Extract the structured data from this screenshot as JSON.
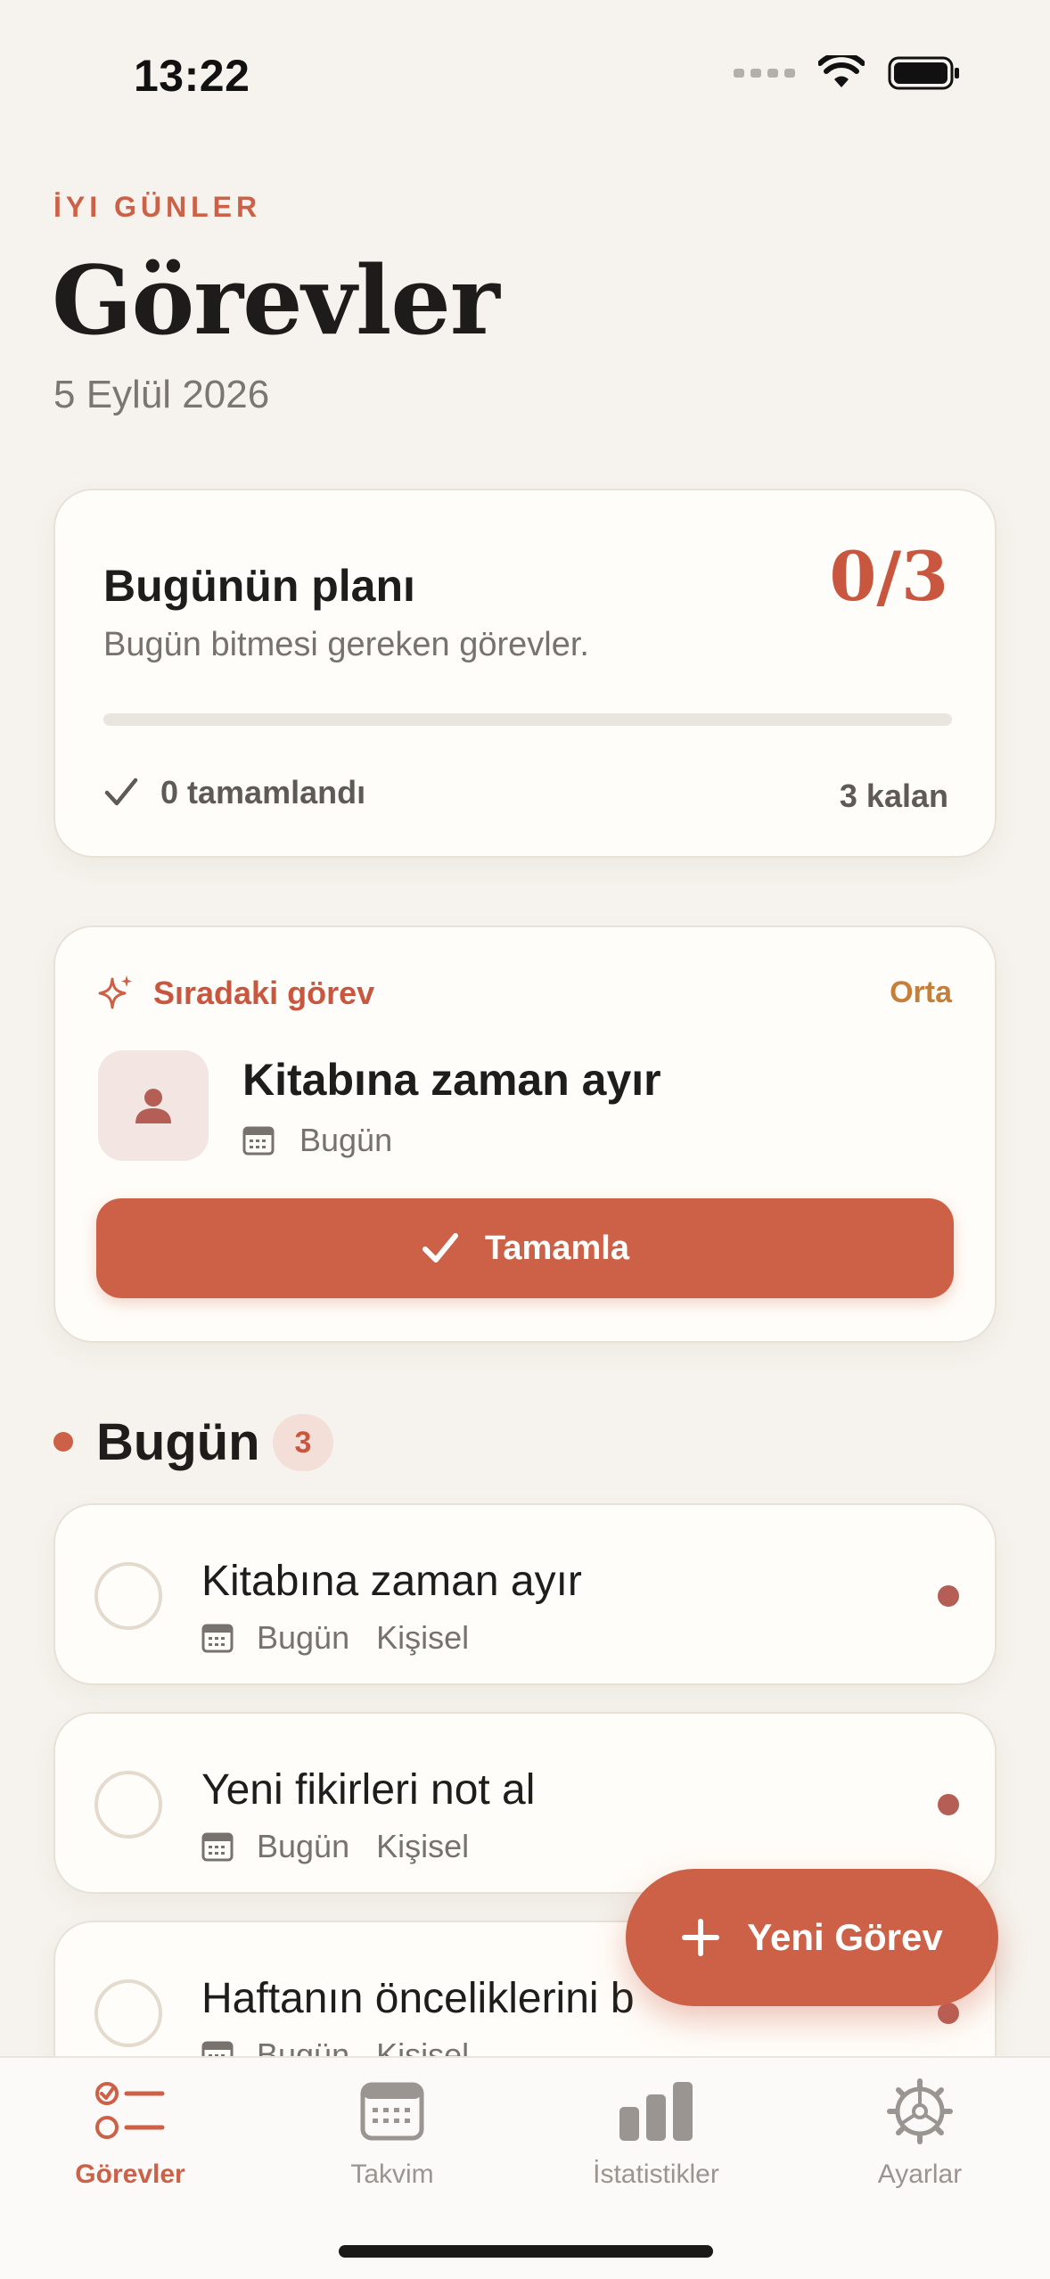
{
  "status_bar": {
    "time": "13:22"
  },
  "header": {
    "greeting": "İYI GÜNLER",
    "title": "Görevler",
    "date": "5 Eylül 2026"
  },
  "plan": {
    "title": "Bugünün planı",
    "count": "0/3",
    "subtitle": "Bugün bitmesi gereken görevler.",
    "progress_fraction": 0,
    "completed_label": "0 tamamlandı",
    "remaining_label": "3 kalan"
  },
  "next_task": {
    "label": "Sıradaki görev",
    "priority": "Orta",
    "title": "Kitabına zaman ayır",
    "date": "Bugün",
    "complete_button": "Tamamla",
    "icon": "person-icon"
  },
  "section": {
    "title": "Bugün",
    "count": "3"
  },
  "tasks": [
    {
      "title": "Kitabına zaman ayır",
      "date": "Bugün",
      "category": "Kişisel"
    },
    {
      "title": "Yeni fikirleri not al",
      "date": "Bugün",
      "category": "Kişisel"
    },
    {
      "title": "Haftanın önceliklerini b",
      "date": "Bugün",
      "category": "Kişisel"
    }
  ],
  "fab": {
    "label": "Yeni Görev"
  },
  "tabbar": {
    "items": [
      {
        "label": "Görevler",
        "icon": "tasks-icon",
        "active": true
      },
      {
        "label": "Takvim",
        "icon": "calendar-icon",
        "active": false
      },
      {
        "label": "İstatistikler",
        "icon": "bar-chart-icon",
        "active": false
      },
      {
        "label": "Ayarlar",
        "icon": "gear-icon",
        "active": false
      }
    ]
  },
  "colors": {
    "accent": "#cc6147",
    "background": "#f6f3ee",
    "card": "#fffdf9",
    "priority_medium": "#c47f3a"
  }
}
